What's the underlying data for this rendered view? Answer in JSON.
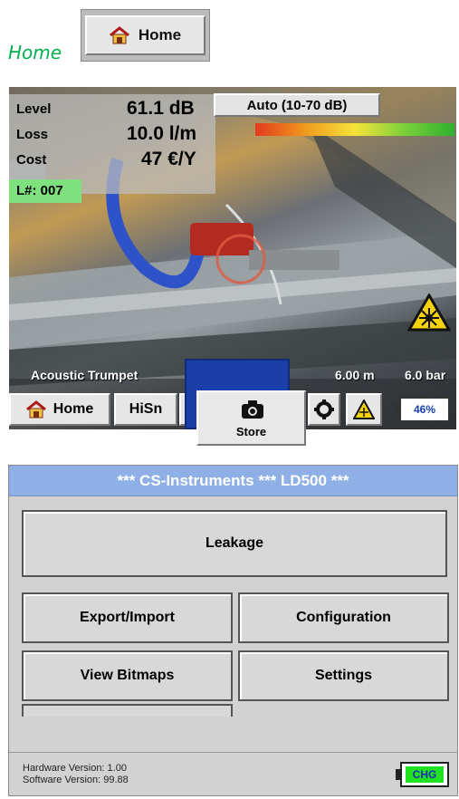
{
  "caption": {
    "label": "Home"
  },
  "home_badge": {
    "label": "Home",
    "icon": "home-icon"
  },
  "camera_screen": {
    "readout": {
      "level_label": "Level",
      "level_value": "61.1 dB",
      "loss_label": "Loss",
      "loss_value": "10.0 l/m",
      "cost_label": "Cost",
      "cost_value": "47 €/Y",
      "leak_number": "L#: 007"
    },
    "range_button": "Auto (10-70 dB)",
    "sensor_label": "Acoustic Trumpet",
    "distance": "6.00 m",
    "pressure": "6.0 bar",
    "toolbar": {
      "home_label": "Home",
      "hisn_label": "HiSn",
      "battery": "46%"
    },
    "store_button": "Store"
  },
  "main_menu": {
    "title": "***  CS-Instruments  ***  LD500  ***",
    "buttons": {
      "leakage": "Leakage",
      "export_import": "Export/Import",
      "configuration": "Configuration",
      "view_bitmaps": "View Bitmaps",
      "settings": "Settings"
    },
    "hardware_version": "Hardware Version: 1.00",
    "software_version": "Software Version: 99.88",
    "charge_badge": "CHG"
  },
  "colors": {
    "caption_green": "#00b050",
    "title_bar_blue": "#8fb0e6",
    "leak_tag_green": "#7ee07e",
    "battery_charge_green": "#22e022"
  }
}
